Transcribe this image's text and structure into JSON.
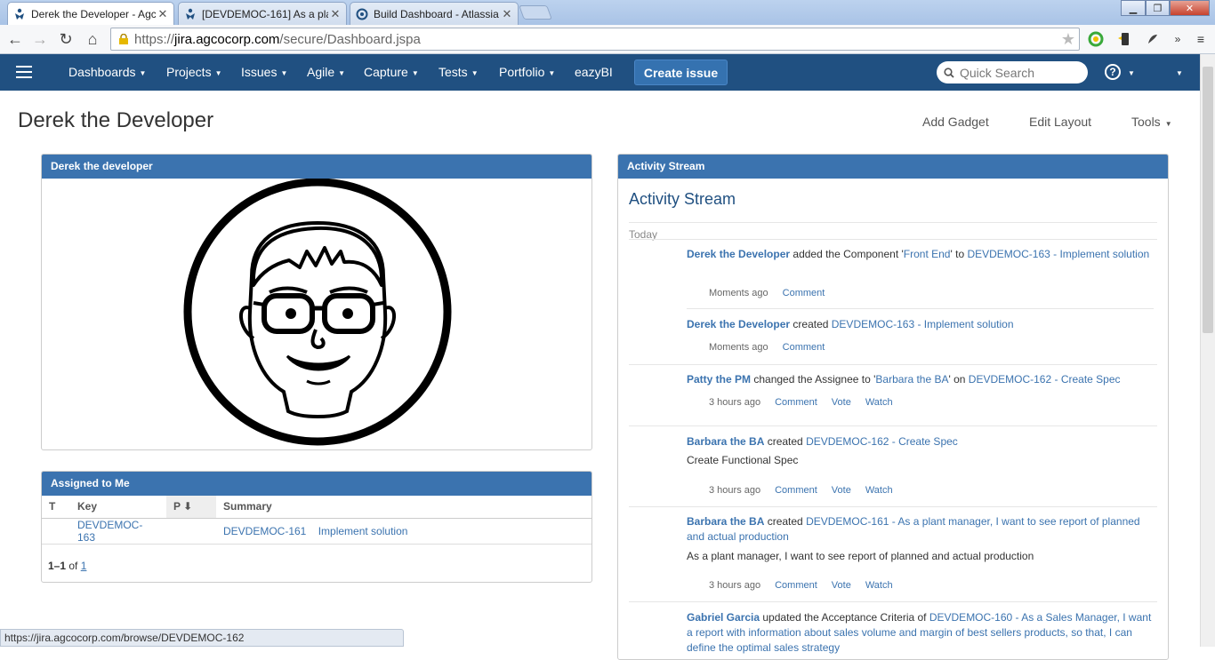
{
  "browser": {
    "tabs": [
      {
        "title": "Derek the Developer - Agc",
        "active": true
      },
      {
        "title": "[DEVDEMOC-161] As a pla",
        "active": false
      },
      {
        "title": "Build Dashboard - Atlassia",
        "active": false
      }
    ],
    "url_prefix": "https://",
    "url_host": "jira.agcocorp.com",
    "url_path": "/secure/Dashboard.jspa",
    "status_url": "https://jira.agcocorp.com/browse/DEVDEMOC-162"
  },
  "header": {
    "nav": [
      {
        "label": "Dashboards",
        "caret": true
      },
      {
        "label": "Projects",
        "caret": true
      },
      {
        "label": "Issues",
        "caret": true
      },
      {
        "label": "Agile",
        "caret": true
      },
      {
        "label": "Capture",
        "caret": true
      },
      {
        "label": "Tests",
        "caret": true
      },
      {
        "label": "Portfolio",
        "caret": true
      },
      {
        "label": "eazyBI",
        "caret": false
      }
    ],
    "create_label": "Create issue",
    "search_placeholder": "Quick Search",
    "brand_color": "#205081"
  },
  "page": {
    "title": "Derek the Developer",
    "actions": {
      "add_gadget": "Add Gadget",
      "edit_layout": "Edit Layout",
      "tools": "Tools"
    }
  },
  "avatar_gadget": {
    "title": "Derek the developer"
  },
  "assigned_gadget": {
    "title": "Assigned to Me",
    "columns": {
      "t": "T",
      "key": "Key",
      "p": "P",
      "summary": "Summary"
    },
    "rows": [
      {
        "key": "DEVDEMOC-163",
        "parent": "DEVDEMOC-161",
        "summary": "Implement solution"
      }
    ],
    "pager": {
      "range": "1–1",
      "of": "of",
      "total": "1"
    }
  },
  "activity": {
    "gadget_title": "Activity Stream",
    "heading": "Activity Stream",
    "today": "Today",
    "entries": [
      {
        "user": "Derek the Developer",
        "text1": " added the Component '",
        "component": "Front End",
        "text2": "' to ",
        "issue": "DEVDEMOC-163 - Implement solution",
        "time": "Moments ago",
        "actions": [
          "Comment"
        ]
      },
      {
        "user": "Derek the Developer",
        "text1": " created ",
        "issue": "DEVDEMOC-163 - Implement solution",
        "time": "Moments ago",
        "actions": [
          "Comment"
        ]
      },
      {
        "user": "Patty the PM",
        "text1": " changed the Assignee to '",
        "assignee": "Barbara the BA",
        "text2": "' on ",
        "issue": "DEVDEMOC-162 - Create Spec",
        "time": "3 hours ago",
        "actions": [
          "Comment",
          "Vote",
          "Watch"
        ]
      },
      {
        "user": "Barbara the BA",
        "text1": " created ",
        "issue": "DEVDEMOC-162 - Create Spec",
        "description": "Create Functional Spec",
        "time": "3 hours ago",
        "actions": [
          "Comment",
          "Vote",
          "Watch"
        ]
      },
      {
        "user": "Barbara the BA",
        "text1": " created ",
        "issue": "DEVDEMOC-161 - As a plant manager, I want to see report of planned and actual production",
        "description": "As a plant manager, I want to see report of planned and actual production",
        "time": "3 hours ago",
        "actions": [
          "Comment",
          "Vote",
          "Watch"
        ]
      },
      {
        "user": "Gabriel Garcia",
        "text1": " updated the Acceptance Criteria of ",
        "issue": "DEVDEMOC-160 - As a Sales Manager, I want a report with information about sales volume and margin of best sellers products, so that, I can define the optimal sales strategy"
      }
    ]
  }
}
